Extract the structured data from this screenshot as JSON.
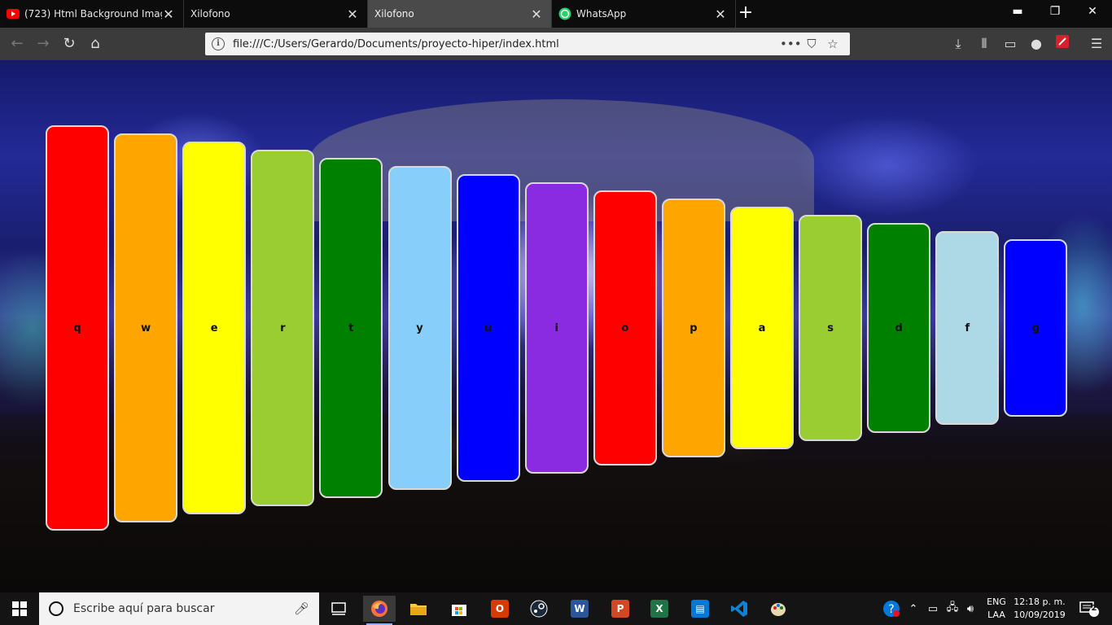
{
  "browser": {
    "tabs": [
      {
        "title": "(723) Html Background Image",
        "icon": "youtube-icon",
        "active": false
      },
      {
        "title": "Xilofono",
        "icon": "",
        "active": false
      },
      {
        "title": "Xilofono",
        "icon": "",
        "active": true
      },
      {
        "title": "WhatsApp",
        "icon": "whatsapp-icon",
        "active": false
      }
    ],
    "url": "file:///C:/Users/Gerardo/Documents/proyecto-hiper/index.html"
  },
  "xylophone": {
    "keys": [
      {
        "label": "q",
        "color": "#ff0000"
      },
      {
        "label": "w",
        "color": "#ffa500"
      },
      {
        "label": "e",
        "color": "#ffff00"
      },
      {
        "label": "r",
        "color": "#9acd32"
      },
      {
        "label": "t",
        "color": "#008000"
      },
      {
        "label": "y",
        "color": "#87cefa"
      },
      {
        "label": "u",
        "color": "#0000ff"
      },
      {
        "label": "i",
        "color": "#8a2be2"
      },
      {
        "label": "o",
        "color": "#ff0000"
      },
      {
        "label": "p",
        "color": "#ffa500"
      },
      {
        "label": "a",
        "color": "#ffff00"
      },
      {
        "label": "s",
        "color": "#9acd32"
      },
      {
        "label": "d",
        "color": "#008000"
      },
      {
        "label": "f",
        "color": "#add8e6"
      },
      {
        "label": "g",
        "color": "#0000ff"
      }
    ]
  },
  "taskbar": {
    "search_placeholder": "Escribe aquí para buscar",
    "lang_line1": "ENG",
    "lang_line2": "LAA",
    "time": "12:18 p. m.",
    "date": "10/09/2019",
    "notifications": "2"
  }
}
